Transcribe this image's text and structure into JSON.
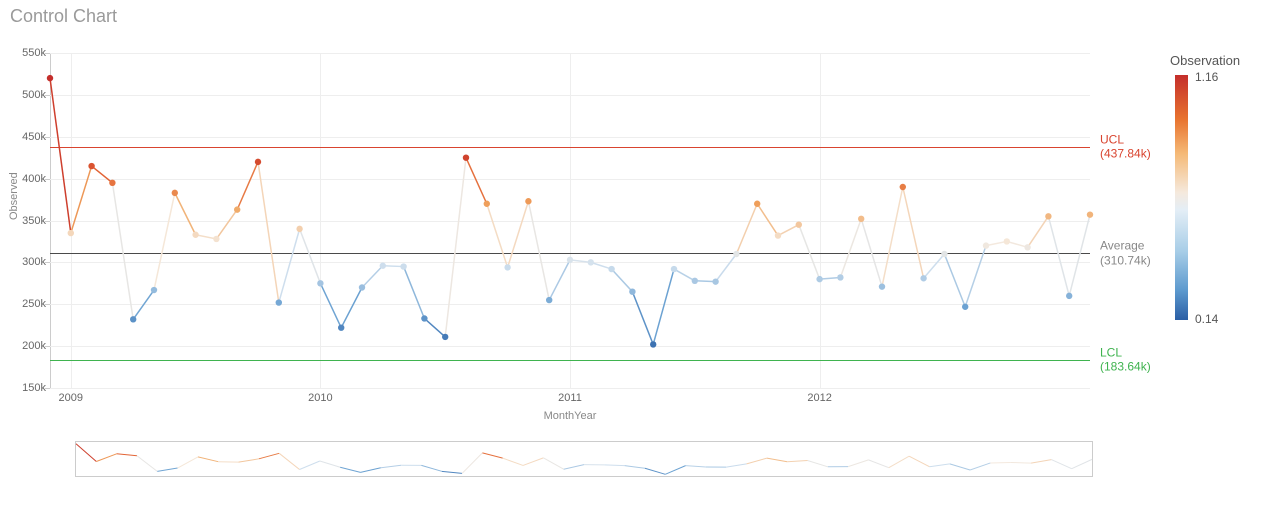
{
  "title": "Control Chart",
  "chart_data": {
    "type": "line",
    "title": "Control Chart",
    "xlabel": "MonthYear",
    "ylabel": "Observed",
    "ylim": [
      150000,
      550000
    ],
    "y_ticks": [
      150000,
      200000,
      250000,
      300000,
      350000,
      400000,
      450000,
      500000,
      550000
    ],
    "y_tick_labels": [
      "150k",
      "200k",
      "250k",
      "300k",
      "350k",
      "400k",
      "450k",
      "500k",
      "550k"
    ],
    "x_major_ticks": [
      "2009",
      "2010",
      "2011",
      "2012"
    ],
    "reference_lines": {
      "UCL": {
        "value": 437840,
        "label": "UCL",
        "value_label": "(437.84k)"
      },
      "Average": {
        "value": 310740,
        "label": "Average",
        "value_label": "(310.74k)"
      },
      "LCL": {
        "value": 183640,
        "label": "LCL",
        "value_label": "(183.64k)"
      }
    },
    "x": [
      "2008-12",
      "2009-01",
      "2009-02",
      "2009-03",
      "2009-04",
      "2009-05",
      "2009-06",
      "2009-07",
      "2009-08",
      "2009-09",
      "2009-10",
      "2009-11",
      "2009-12",
      "2010-01",
      "2010-02",
      "2010-03",
      "2010-04",
      "2010-05",
      "2010-06",
      "2010-07",
      "2010-08",
      "2010-09",
      "2010-10",
      "2010-11",
      "2010-12",
      "2011-01",
      "2011-02",
      "2011-03",
      "2011-04",
      "2011-05",
      "2011-06",
      "2011-07",
      "2011-08",
      "2011-09",
      "2011-10",
      "2011-11",
      "2011-12",
      "2012-01",
      "2012-02",
      "2012-03",
      "2012-04",
      "2012-05",
      "2012-06",
      "2012-07",
      "2012-08",
      "2012-09",
      "2012-10"
    ],
    "values": [
      520000,
      335000,
      415000,
      395000,
      232000,
      267000,
      383000,
      333000,
      328000,
      363000,
      420000,
      252000,
      340000,
      275000,
      222000,
      270000,
      296000,
      295000,
      233000,
      211000,
      425000,
      370000,
      294000,
      373000,
      255000,
      303000,
      300000,
      292000,
      265000,
      202000,
      292000,
      278000,
      277000,
      310000,
      370000,
      332000,
      345000,
      280000,
      282000,
      352000,
      271000,
      390000,
      281000,
      310000,
      247000,
      320000,
      325000
    ],
    "values_extra": [
      318000,
      355000,
      260000,
      357000
    ],
    "color_scale": {
      "name": "Observation",
      "min": 0.14,
      "max": 1.16
    }
  },
  "legend": {
    "title": "Observation",
    "top_label": "1.16",
    "bottom_label": "0.14"
  },
  "xlabel_display": "MonthYear"
}
